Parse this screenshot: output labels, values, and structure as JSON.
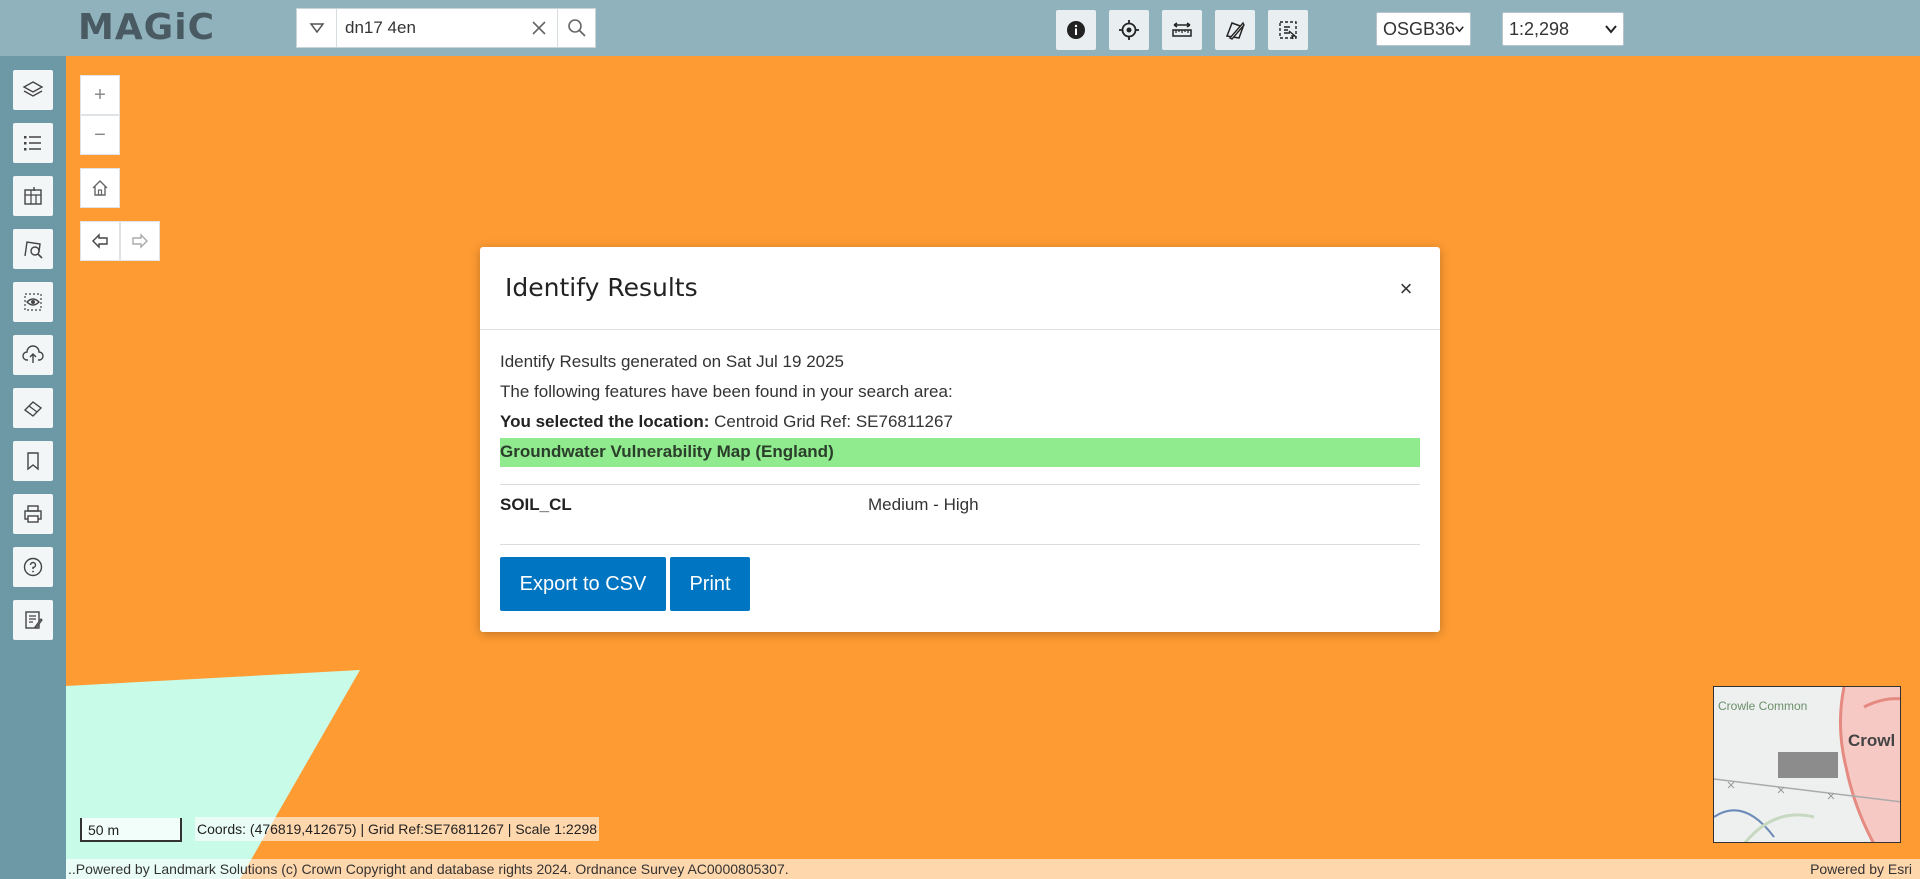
{
  "header": {
    "logo_text": "MAGiC",
    "search": {
      "value": "dn17 4en",
      "placeholder": ""
    },
    "tools": [
      {
        "icon": "info-icon"
      },
      {
        "icon": "locate-icon"
      },
      {
        "icon": "measure-icon"
      },
      {
        "icon": "draw-icon"
      },
      {
        "icon": "select-area-icon"
      }
    ],
    "projection": "OSGB36",
    "scale": "1:2,298"
  },
  "sidebar": {
    "items": [
      {
        "icon": "layers-icon"
      },
      {
        "icon": "legend-list-icon"
      },
      {
        "icon": "map-grid-icon"
      },
      {
        "icon": "identify-area-icon"
      },
      {
        "icon": "view-extent-icon"
      },
      {
        "icon": "upload-icon"
      },
      {
        "icon": "eraser-icon"
      },
      {
        "icon": "bookmark-icon"
      },
      {
        "icon": "print-icon"
      },
      {
        "icon": "help-icon"
      },
      {
        "icon": "notes-icon"
      }
    ]
  },
  "map": {
    "zoom_in": "+",
    "zoom_out": "−",
    "scale_bar": "50 m",
    "coords_text": "Coords: (476819,412675) | Grid Ref:SE76811267 | Scale 1:2298",
    "attribution_left": "..Powered by Landmark Solutions (c) Crown Copyright and database rights 2024. Ordnance Survey AC0000805307.",
    "attribution_right": "Powered by Esri",
    "overview": {
      "label1": "Crowle Common",
      "label2": "Crowl"
    },
    "colors": {
      "map_fill": "#fe9b32",
      "teal_area": "#c8fbe8"
    }
  },
  "dialog": {
    "title": "Identify Results",
    "close": "×",
    "generated": "Identify Results generated on Sat Jul 19 2025",
    "found": "The following features have been found in your search area:",
    "selected_label": "You selected the location:",
    "selected_value": "Centroid Grid Ref: SE76811267",
    "layer_name": "Groundwater Vulnerability Map (England)",
    "layer_color": "#90ea8e",
    "attribute_key": "SOIL_CL",
    "attribute_value": "Medium - High",
    "export_button": "Export to CSV",
    "print_button": "Print"
  }
}
